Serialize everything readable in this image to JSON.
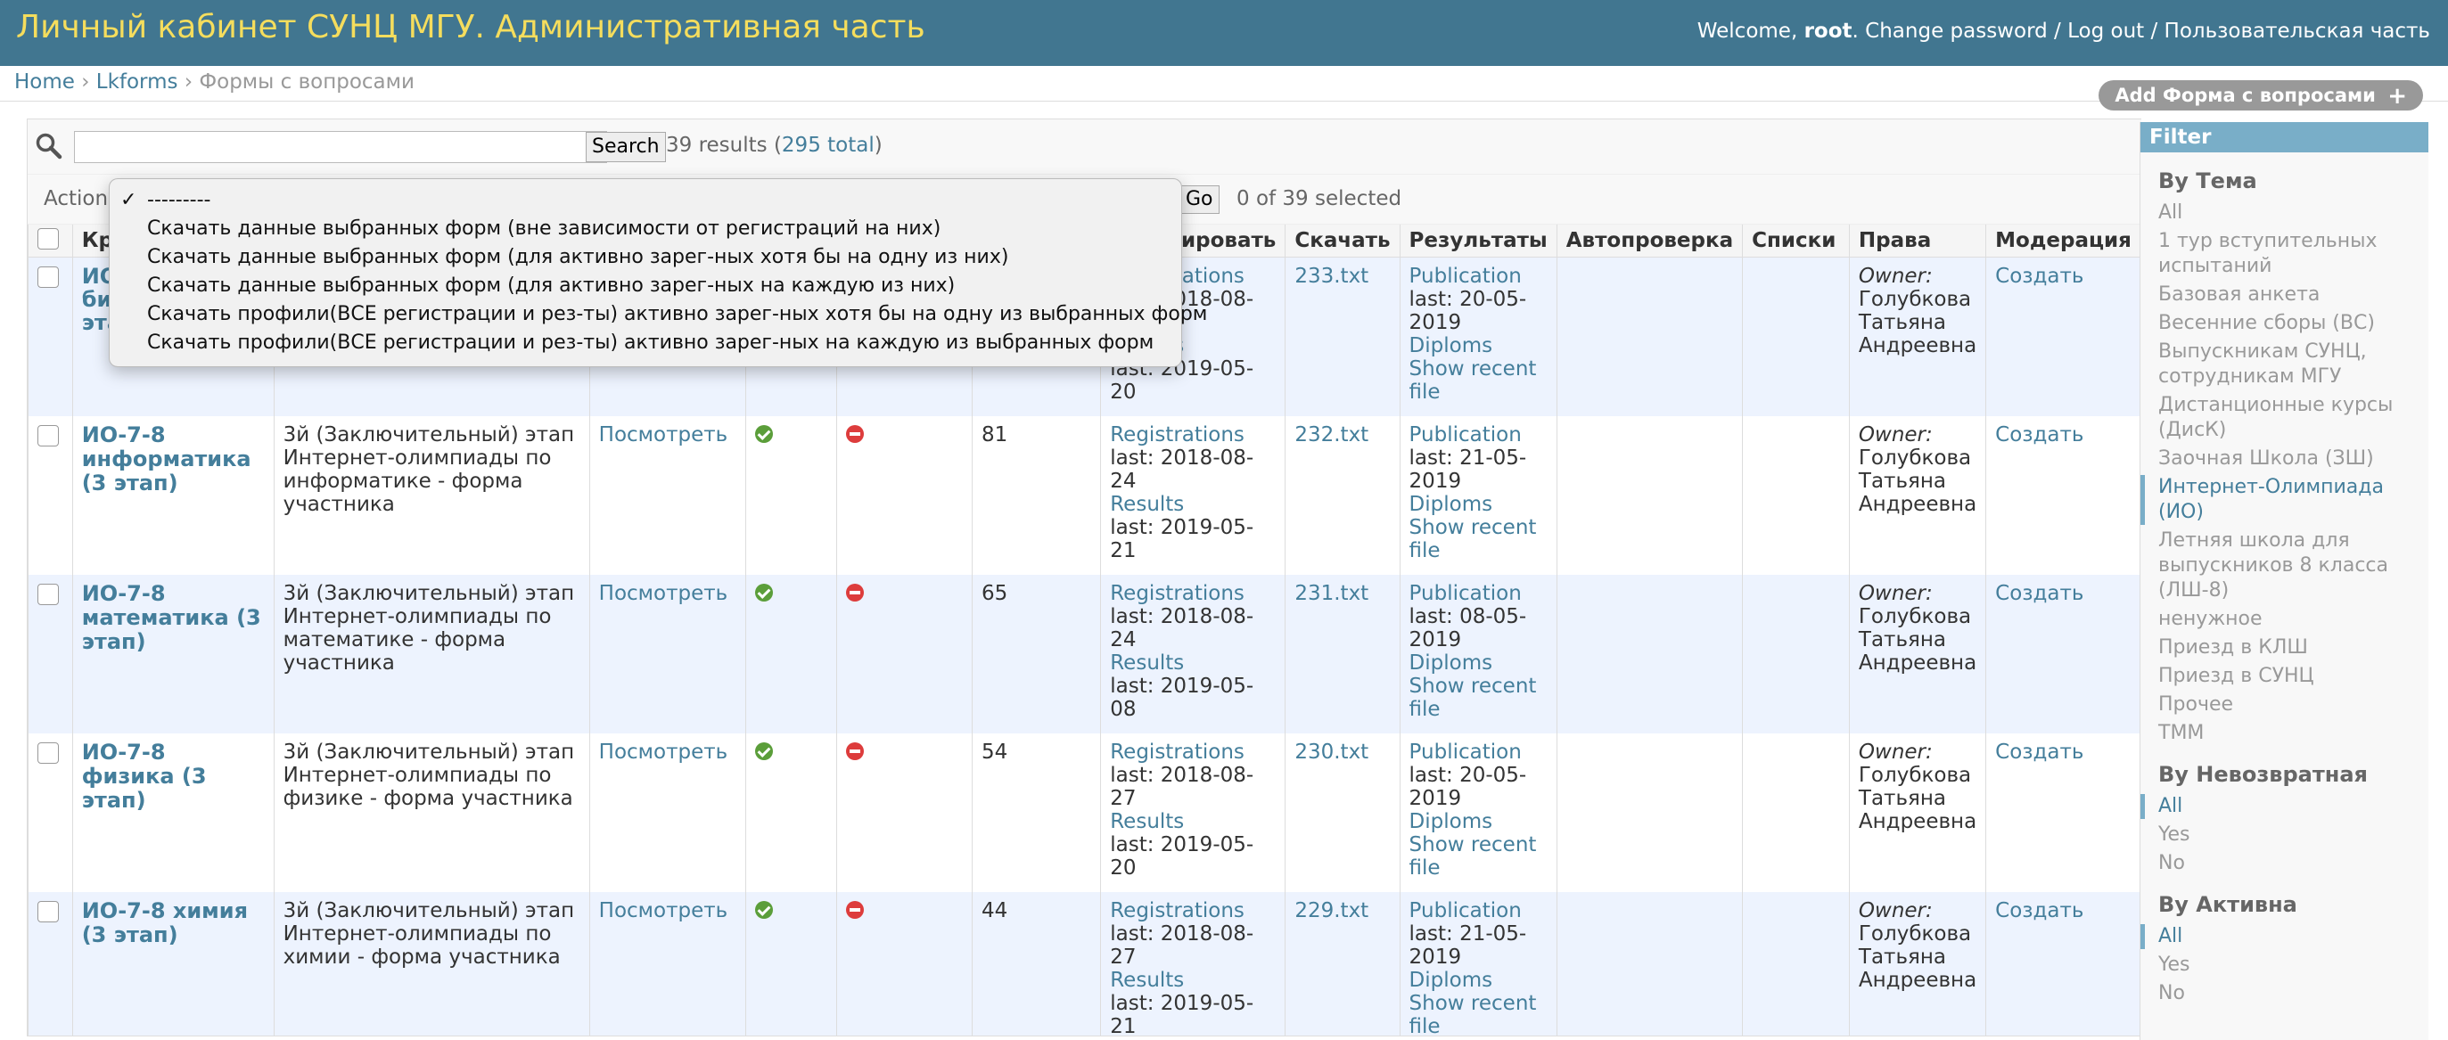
{
  "header": {
    "site_title": "Личный кабинет СУНЦ МГУ. Административная часть",
    "welcome": "Welcome,",
    "username": "root",
    "change_password": "Change password",
    "logout": "Log out",
    "user_part": "Пользовательская часть",
    "separator": "/"
  },
  "breadcrumbs": {
    "home": "Home",
    "app": "Lkforms",
    "current": "Формы с вопросами",
    "sep": "›"
  },
  "add_button": {
    "label": "Add Форма с вопросами",
    "icon": "plus-icon"
  },
  "search": {
    "placeholder": "",
    "button_label": "Search",
    "results_text": "39 results (",
    "total_link": "295 total",
    "results_close": ")"
  },
  "actions": {
    "label": "Action:",
    "go_label": "Go",
    "counter": "0 of 39 selected",
    "menu": [
      {
        "label": "---------",
        "checked": true
      },
      {
        "label": "Скачать данные выбранных форм (вне зависимости от регистраций на них)",
        "checked": false
      },
      {
        "label": "Скачать данные выбранных форм (для активно зарег-ных хотя бы на одну из них)",
        "checked": false
      },
      {
        "label": "Скачать данные выбранных форм (для активно зарег-ных на каждую из них)",
        "checked": false
      },
      {
        "label": "Скачать профили(ВСЕ регистрации и рез-ты) активно зарег-ных хотя бы на одну из выбранных форм",
        "checked": false
      },
      {
        "label": "Скачать профили(ВСЕ регистрации и рез-ты) активно зарег-ных на каждую из выбранных форм",
        "checked": false
      }
    ]
  },
  "table": {
    "headers": {
      "short": "Кра",
      "count_tail": "й",
      "archive": "Архивировать",
      "download": "Скачать",
      "results": "Результаты",
      "autocheck": "Автопроверка",
      "lists": "Списки",
      "rights": "Права",
      "moderation": "Модерация"
    },
    "rows": [
      {
        "title_l1": "ИО",
        "title_l2": "би",
        "title_l3": "эта",
        "description": "",
        "view": "",
        "count": "",
        "reg_link": "Registrations",
        "reg_last": "last: 2018-08-24",
        "res_link": "Results",
        "res_last": "last: 2019-05-20",
        "file": "233.txt",
        "publication": "Publication",
        "pub_last": "last: 20-05-2019",
        "diplomas": "Diploms",
        "show_recent": "Show recent file",
        "owner_label": "Owner:",
        "owner_name": "Голубкова Татьяна Андреевна",
        "create": "Создать"
      },
      {
        "title": "ИО-7-8 информатика (3 этап)",
        "description": "3й (Заключительный) этап Интернет-олимпиады по информатике - форма участника",
        "view": "Посмотреть",
        "count": "81",
        "reg_link": "Registrations",
        "reg_last": "last: 2018-08-24",
        "res_link": "Results",
        "res_last": "last: 2019-05-21",
        "file": "232.txt",
        "publication": "Publication",
        "pub_last": "last: 21-05-2019",
        "diplomas": "Diploms",
        "show_recent": "Show recent file",
        "owner_label": "Owner:",
        "owner_name": "Голубкова Татьяна Андреевна",
        "create": "Создать"
      },
      {
        "title": "ИО-7-8 математика (3 этап)",
        "description": "3й (Заключительный) этап Интернет-олимпиады по математике - форма участника",
        "view": "Посмотреть",
        "count": "65",
        "reg_link": "Registrations",
        "reg_last": "last: 2018-08-24",
        "res_link": "Results",
        "res_last": "last: 2019-05-08",
        "file": "231.txt",
        "publication": "Publication",
        "pub_last": "last: 08-05-2019",
        "diplomas": "Diploms",
        "show_recent": "Show recent file",
        "owner_label": "Owner:",
        "owner_name": "Голубкова Татьяна Андреевна",
        "create": "Создать"
      },
      {
        "title": "ИО-7-8 физика (3 этап)",
        "description": "3й (Заключительный) этап Интернет-олимпиады по физике - форма участника",
        "view": "Посмотреть",
        "count": "54",
        "reg_link": "Registrations",
        "reg_last": "last: 2018-08-27",
        "res_link": "Results",
        "res_last": "last: 2019-05-20",
        "file": "230.txt",
        "publication": "Publication",
        "pub_last": "last: 20-05-2019",
        "diplomas": "Diploms",
        "show_recent": "Show recent file",
        "owner_label": "Owner:",
        "owner_name": "Голубкова Татьяна Андреевна",
        "create": "Создать"
      },
      {
        "title": "ИО-7-8 химия (3 этап)",
        "description": "3й (Заключительный) этап Интернет-олимпиады по химии - форма участника",
        "view": "Посмотреть",
        "count": "44",
        "reg_link": "Registrations",
        "reg_last": "last: 2018-08-27",
        "res_link": "Results",
        "res_last": "last: 2019-05-21",
        "file": "229.txt",
        "publication": "Publication",
        "pub_last": "last: 21-05-2019",
        "diplomas": "Diploms",
        "show_recent": "Show recent file",
        "owner_label": "Owner:",
        "owner_name": "Голубкова Татьяна Андреевна",
        "create": "Создать"
      }
    ]
  },
  "filter": {
    "title": "Filter",
    "groups": [
      {
        "heading": "By Тема",
        "items": [
          {
            "label": "All",
            "selected": false
          },
          {
            "label": "1 тур вступительных испытаний",
            "selected": false
          },
          {
            "label": "Базовая анкета",
            "selected": false
          },
          {
            "label": "Весенние сборы (ВС)",
            "selected": false
          },
          {
            "label": "Выпускникам СУНЦ, сотрудникам МГУ",
            "selected": false
          },
          {
            "label": "Дистанционные курсы (ДисК)",
            "selected": false
          },
          {
            "label": "Заочная Школа (ЗШ)",
            "selected": false
          },
          {
            "label": "Интернет-Олимпиада (ИО)",
            "selected": true
          },
          {
            "label": "Летняя школа для выпускников 8 класса (ЛШ-8)",
            "selected": false
          },
          {
            "label": "ненужное",
            "selected": false
          },
          {
            "label": "Приезд в КЛШ",
            "selected": false
          },
          {
            "label": "Приезд в СУНЦ",
            "selected": false
          },
          {
            "label": "Прочее",
            "selected": false
          },
          {
            "label": "ТММ",
            "selected": false
          }
        ]
      },
      {
        "heading": "By Невозвратная",
        "items": [
          {
            "label": "All",
            "selected": true
          },
          {
            "label": "Yes",
            "selected": false
          },
          {
            "label": "No",
            "selected": false
          }
        ]
      },
      {
        "heading": "By Активна",
        "items": [
          {
            "label": "All",
            "selected": true
          },
          {
            "label": "Yes",
            "selected": false
          },
          {
            "label": "No",
            "selected": false
          }
        ]
      }
    ]
  },
  "colors": {
    "header_bg": "#417690",
    "brand_yellow": "#f5dd5d",
    "link": "#447e9b",
    "row_alt": "#edf3fe",
    "yes_green": "#5b9e3a",
    "no_red": "#dd3c3c"
  }
}
